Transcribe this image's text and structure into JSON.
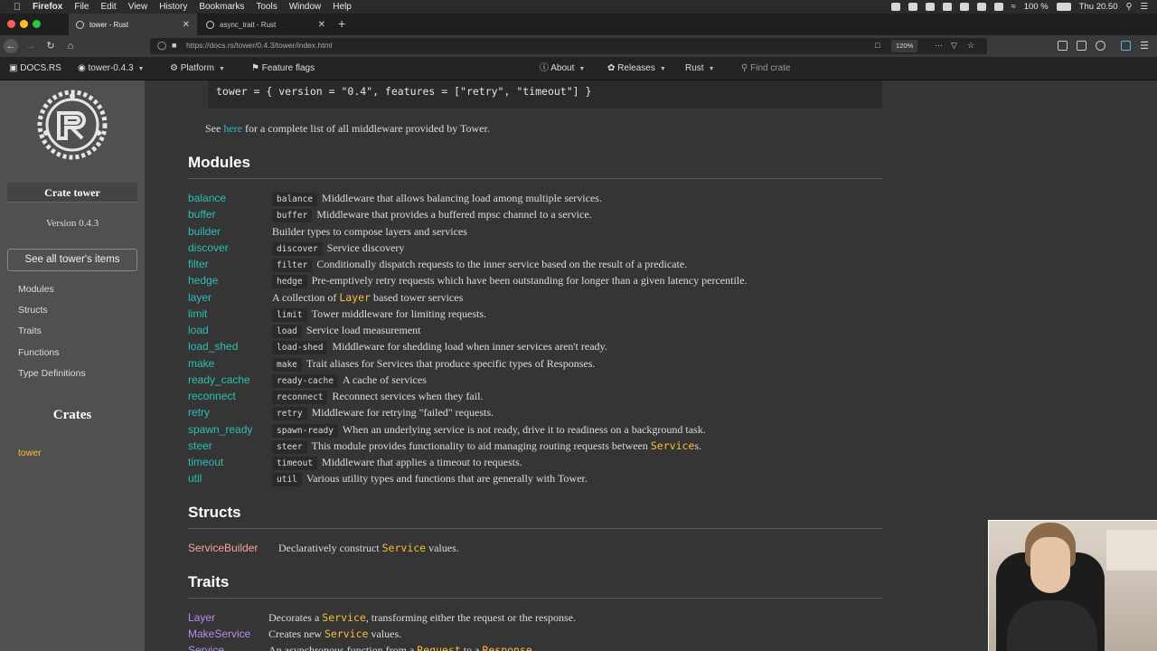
{
  "menubar": {
    "app": "Firefox",
    "items": [
      "File",
      "Edit",
      "View",
      "History",
      "Bookmarks",
      "Tools",
      "Window",
      "Help"
    ],
    "battery": "100 %",
    "clock": "Thu 20.50"
  },
  "tabs": [
    {
      "title": "tower - Rust"
    },
    {
      "title": "async_trait - Rust"
    }
  ],
  "browser": {
    "url": "https://docs.rs/tower/0.4.3/tower/index.html",
    "zoom": "120%"
  },
  "docsnav": {
    "logo": "DOCS.RS",
    "crate": "tower-0.4.3",
    "platform": "Platform",
    "feature_flags": "Feature flags",
    "about": "About",
    "releases": "Releases",
    "rust": "Rust",
    "search_placeholder": "Find crate"
  },
  "sidebar": {
    "crate_title": "Crate tower",
    "version": "Version 0.4.3",
    "all_items": "See all tower's items",
    "links": [
      "Modules",
      "Structs",
      "Traits",
      "Functions",
      "Type Definitions"
    ],
    "crates_heading": "Crates",
    "crates": [
      "tower"
    ]
  },
  "main": {
    "code_line": "tower = { version = \"0.4\", features = [\"retry\", \"timeout\"] }",
    "see_prefix": "See ",
    "see_link": "here",
    "see_suffix": " for a complete list of all middleware provided by Tower.",
    "modules_heading": "Modules",
    "modules": [
      {
        "name": "balance",
        "tag": "balance",
        "desc": "Middleware that allows balancing load among multiple services."
      },
      {
        "name": "buffer",
        "tag": "buffer",
        "desc": "Middleware that provides a buffered mpsc channel to a service."
      },
      {
        "name": "builder",
        "tag": "",
        "desc": "Builder types to compose layers and services"
      },
      {
        "name": "discover",
        "tag": "discover",
        "desc": "Service discovery"
      },
      {
        "name": "filter",
        "tag": "filter",
        "desc": "Conditionally dispatch requests to the inner service based on the result of a predicate."
      },
      {
        "name": "hedge",
        "tag": "hedge",
        "desc": "Pre-emptively retry requests which have been outstanding for longer than a given latency percentile."
      },
      {
        "name": "layer",
        "tag": "",
        "desc_pre": "A collection of ",
        "desc_code": "Layer",
        "desc_post": " based tower services"
      },
      {
        "name": "limit",
        "tag": "limit",
        "desc": "Tower middleware for limiting requests."
      },
      {
        "name": "load",
        "tag": "load",
        "desc": "Service load measurement"
      },
      {
        "name": "load_shed",
        "tag": "load-shed",
        "desc": "Middleware for shedding load when inner services aren't ready."
      },
      {
        "name": "make",
        "tag": "make",
        "desc": "Trait aliases for Services that produce specific types of Responses."
      },
      {
        "name": "ready_cache",
        "tag": "ready-cache",
        "desc": "A cache of services"
      },
      {
        "name": "reconnect",
        "tag": "reconnect",
        "desc": "Reconnect services when they fail."
      },
      {
        "name": "retry",
        "tag": "retry",
        "desc": "Middleware for retrying \"failed\" requests."
      },
      {
        "name": "spawn_ready",
        "tag": "spawn-ready",
        "desc": "When an underlying service is not ready, drive it to readiness on a background task."
      },
      {
        "name": "steer",
        "tag": "steer",
        "desc_pre": "This module provides functionality to aid managing routing requests between ",
        "desc_code": "Service",
        "desc_post": "s."
      },
      {
        "name": "timeout",
        "tag": "timeout",
        "desc": "Middleware that applies a timeout to requests."
      },
      {
        "name": "util",
        "tag": "util",
        "desc": "Various utility types and functions that are generally with Tower."
      }
    ],
    "structs_heading": "Structs",
    "structs": [
      {
        "name": "ServiceBuilder",
        "pre": "Declaratively construct ",
        "code": "Service",
        "post": " values."
      }
    ],
    "traits_heading": "Traits",
    "traits": [
      {
        "name": "Layer",
        "pre": "Decorates a ",
        "code": "Service",
        "post": ", transforming either the request or the response."
      },
      {
        "name": "MakeService",
        "pre": "Creates new ",
        "code": "Service",
        "post": " values."
      },
      {
        "name": "Service",
        "pre": "An asynchronous function from a ",
        "code": "Request",
        "post": " to a ",
        "code2": "Response",
        "post2": "."
      }
    ]
  },
  "colors": {
    "link": "#39afd7",
    "module": "#2dbfb8",
    "struct": "#ffa0a5",
    "trait": "#b78cf2",
    "code_orange": "#fdbf35"
  }
}
